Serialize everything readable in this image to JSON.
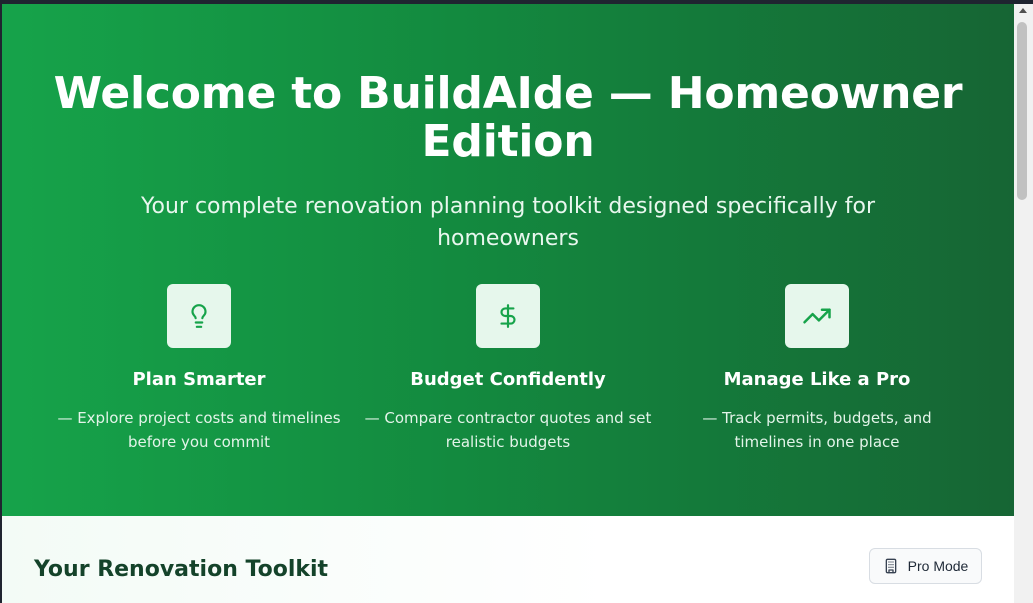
{
  "hero": {
    "title": "Welcome to BuildAIde — Homeowner Edition",
    "subtitle": "Your complete renovation planning toolkit designed specifically for homeowners",
    "features": [
      {
        "icon": "lightbulb-icon",
        "title": "Plan Smarter",
        "text": "— Explore project costs and timelines before you commit"
      },
      {
        "icon": "dollar-sign-icon",
        "title": "Budget Confidently",
        "text": "— Compare contractor quotes and set realistic budgets"
      },
      {
        "icon": "trending-up-icon",
        "title": "Manage Like a Pro",
        "text": "— Track permits, budgets, and timelines in one place"
      }
    ]
  },
  "toolkit": {
    "title": "Your Renovation Toolkit",
    "pro_mode_label": "Pro Mode",
    "pro_mode_icon": "building-icon"
  },
  "colors": {
    "hero_gradient_start": "#16a34a",
    "hero_gradient_end": "#166534",
    "icon_accent": "#16a34a",
    "icon_tile": "#e6f7ec",
    "toolkit_title": "#14432a"
  }
}
